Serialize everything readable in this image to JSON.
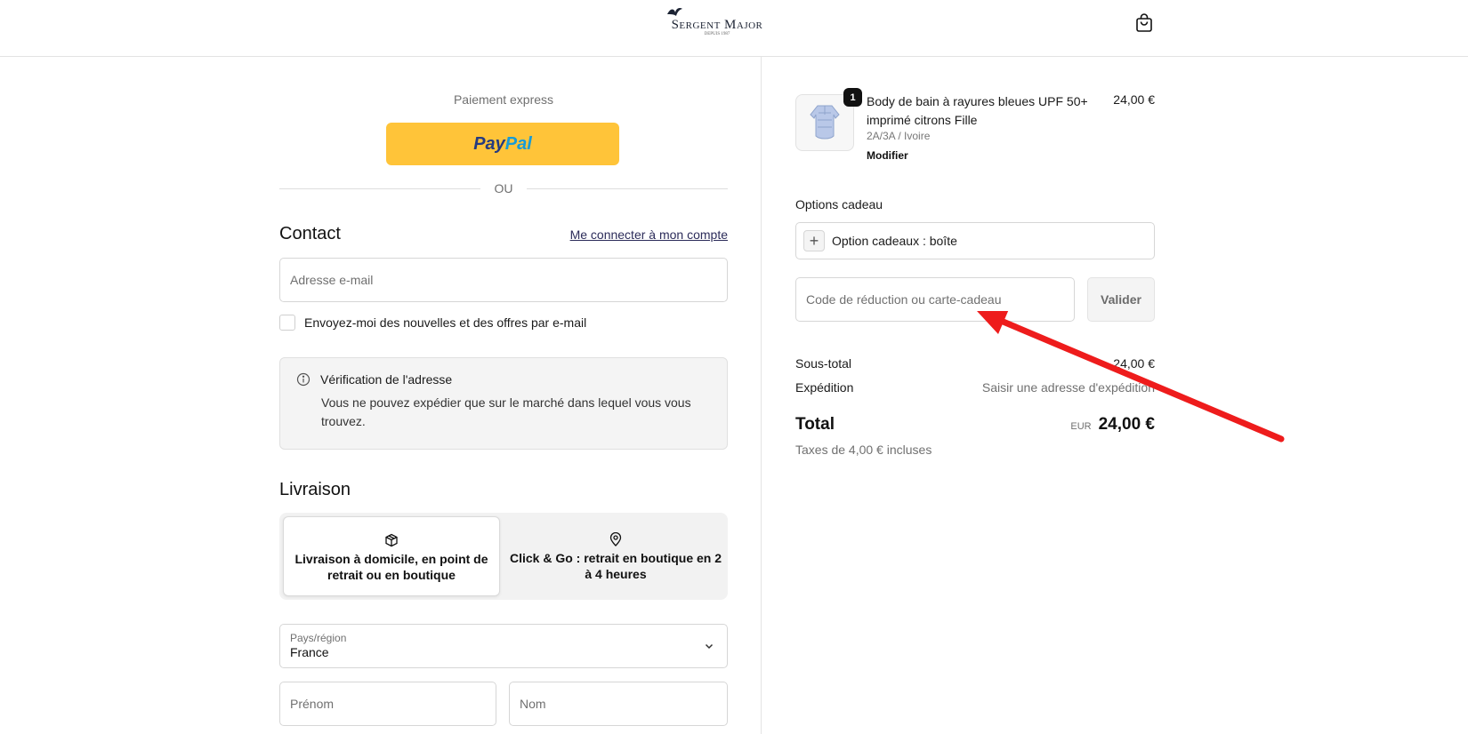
{
  "header": {
    "brand": "Sergent Major",
    "brand_sub": "DEPUIS 1987",
    "cart_icon": "shopping-bag-icon"
  },
  "express": {
    "label": "Paiement express",
    "paypal_part1": "Pay",
    "paypal_part2": "Pal",
    "or_label": "OU"
  },
  "contact": {
    "title": "Contact",
    "login_link": "Me connecter à mon compte",
    "email_placeholder": "Adresse e-mail",
    "newsletter_label": "Envoyez-moi des nouvelles et des offres par e-mail"
  },
  "notice": {
    "icon": "info-icon",
    "title": "Vérification de l'adresse",
    "text": "Vous ne pouvez expédier que sur le marché dans lequel vous vous trouvez."
  },
  "delivery": {
    "title": "Livraison",
    "options": [
      {
        "icon": "package-icon",
        "label": "Livraison à domicile, en point de retrait ou en boutique",
        "selected": true
      },
      {
        "icon": "map-pin-icon",
        "label": "Click & Go : retrait en boutique en 2 à 4 heures",
        "selected": false
      }
    ],
    "country_label": "Pays/région",
    "country_value": "France",
    "firstname_placeholder": "Prénom",
    "lastname_placeholder": "Nom"
  },
  "summary": {
    "product": {
      "quantity": "1",
      "name": "Body de bain à rayures bleues UPF 50+ imprimé citrons Fille",
      "price": "24,00 €",
      "variant": "2A/3A / Ivoire",
      "modify_label": "Modifier"
    },
    "gift_title": "Options cadeau",
    "gift_option": "Option cadeaux : boîte",
    "discount_placeholder": "Code de réduction ou carte-cadeau",
    "apply_label": "Valider",
    "subtotal_label": "Sous-total",
    "subtotal_value": "24,00 €",
    "shipping_label": "Expédition",
    "shipping_value": "Saisir une adresse d'expédition",
    "total_label": "Total",
    "total_currency": "EUR",
    "total_value": "24,00 €",
    "taxes": "Taxes de 4,00 € incluses"
  },
  "colors": {
    "paypal_yellow": "#ffc439",
    "annotation_arrow": "#ee1c1c"
  }
}
